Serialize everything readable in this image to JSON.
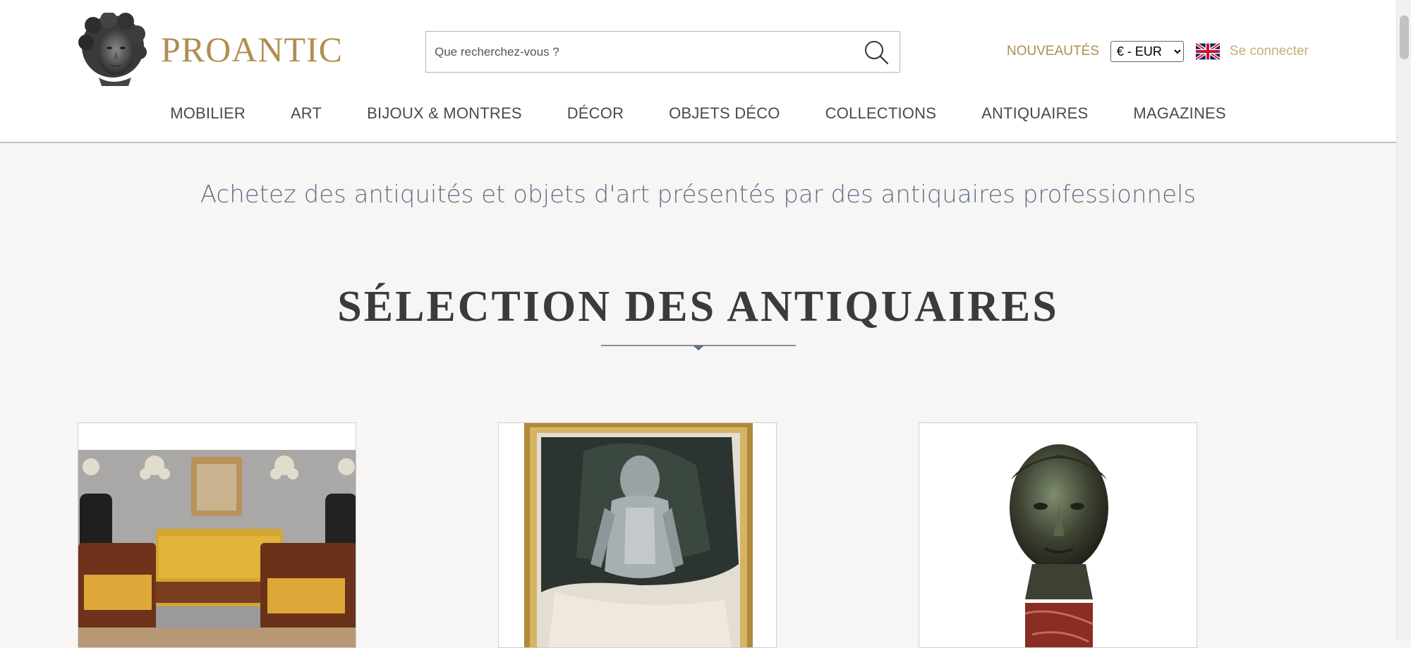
{
  "header": {
    "logo_text": "PROANTIC",
    "search_placeholder": "Que recherchez-vous ?",
    "nouveautes": "NOUVEAUTÉS",
    "currency": "€ - EUR",
    "login": "Se connecter",
    "language_flag": "uk-flag-icon"
  },
  "nav": {
    "items": [
      "MOBILIER",
      "ART",
      "BIJOUX & MONTRES",
      "DÉCOR",
      "OBJETS DÉCO",
      "COLLECTIONS",
      "ANTIQUAIRES",
      "MAGAZINES"
    ]
  },
  "main": {
    "tagline": "Achetez des antiquités et objets d'art présentés par des antiquaires professionnels",
    "section_title": "SÉLECTION DES ANTIQUAIRES"
  },
  "colors": {
    "gold": "#b08e4f",
    "blue_grey": "#5d7089",
    "background": "#f7f6f4"
  }
}
